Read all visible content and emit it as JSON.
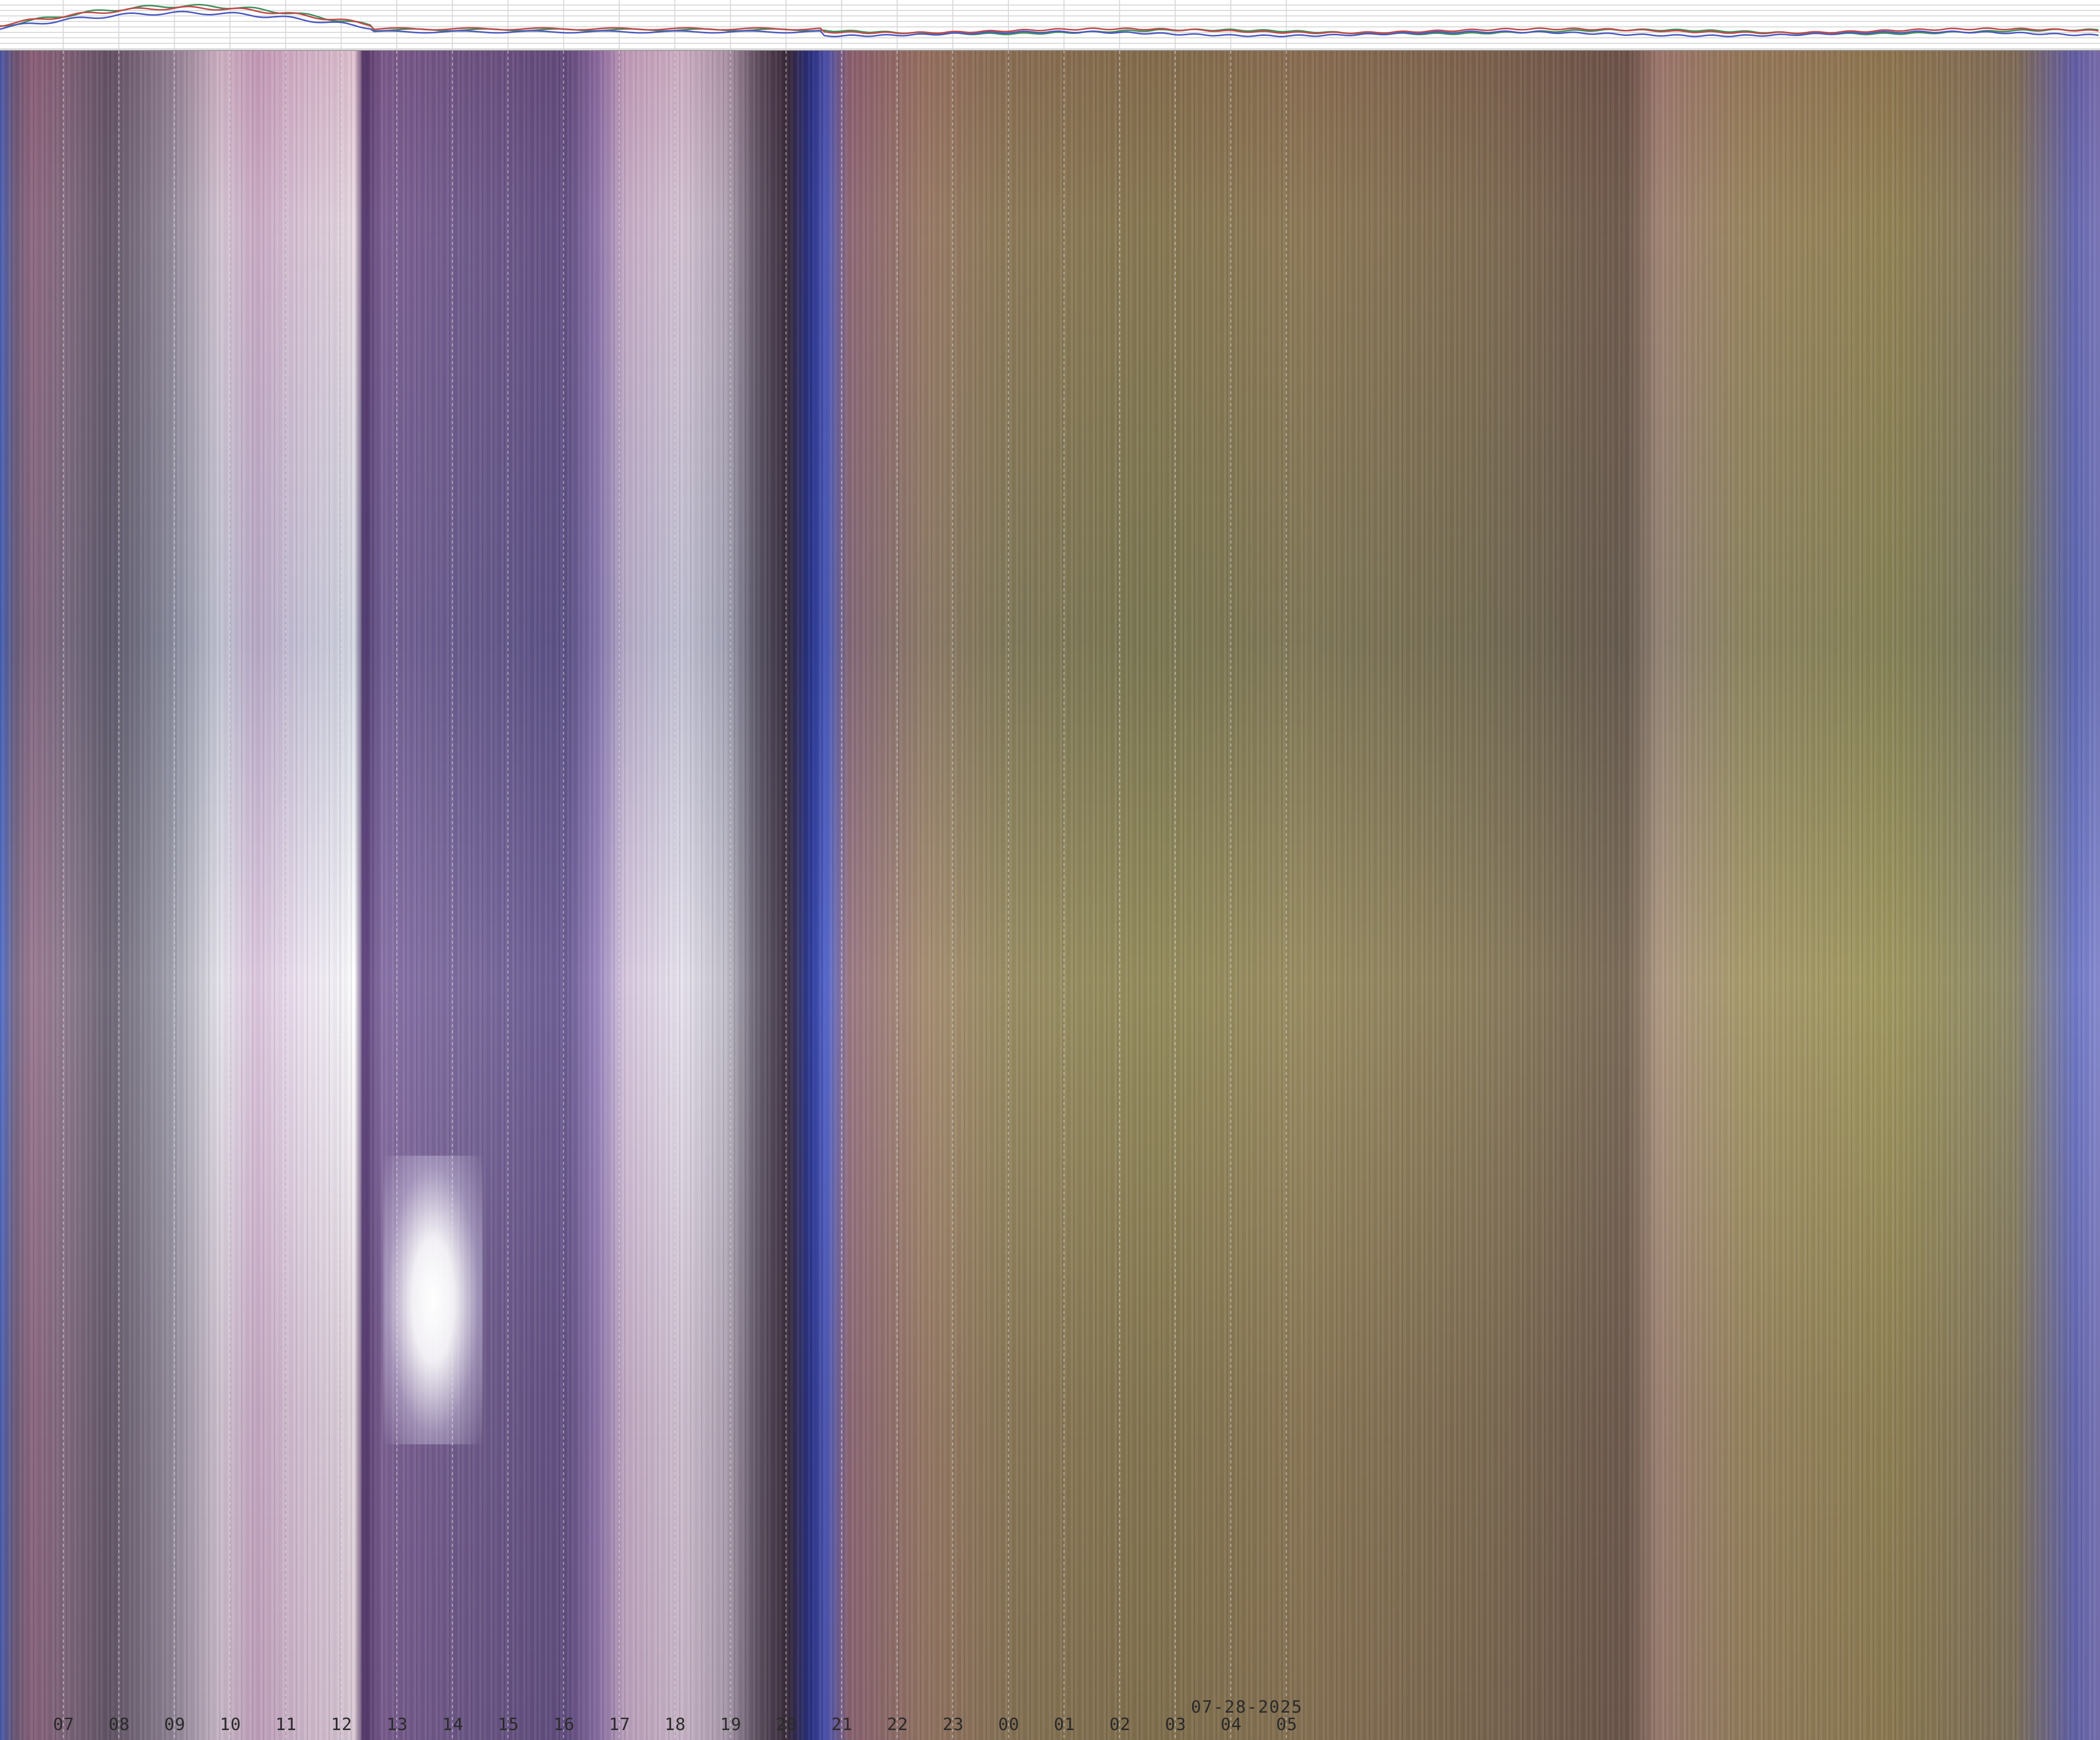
{
  "hours": [
    {
      "label": "07"
    },
    {
      "label": "08"
    },
    {
      "label": "09"
    },
    {
      "label": "10"
    },
    {
      "label": "11"
    },
    {
      "label": "12"
    },
    {
      "label": "13"
    },
    {
      "label": "14"
    },
    {
      "label": "15"
    },
    {
      "label": "16"
    },
    {
      "label": "17"
    },
    {
      "label": "18"
    },
    {
      "label": "19"
    },
    {
      "label": "20"
    },
    {
      "label": "21"
    },
    {
      "label": "22"
    },
    {
      "label": "23"
    },
    {
      "label": "00"
    },
    {
      "label": "01"
    },
    {
      "label": "02"
    },
    {
      "label": "03"
    },
    {
      "label": "04"
    },
    {
      "label": "05"
    }
  ],
  "date": "07-28-2025",
  "colors": {
    "grid_line": "#d8d8d8",
    "series_green": "#3f8f5a",
    "series_red": "#c04a4a",
    "series_blue": "#4a5ac0"
  }
}
